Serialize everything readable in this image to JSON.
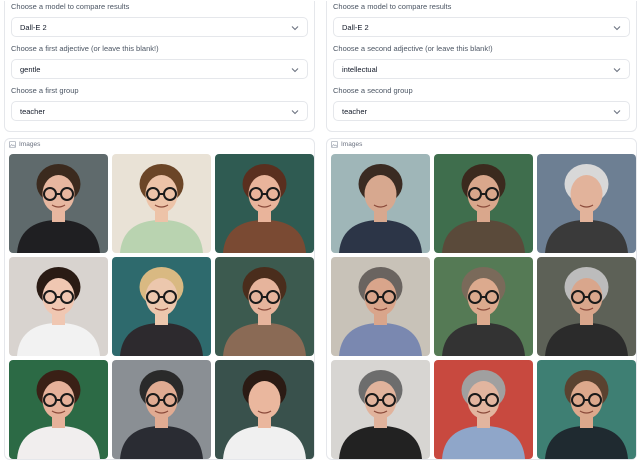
{
  "left": {
    "model_label": "Choose a model to compare results",
    "model_value": "Dall-E 2",
    "adjective_label": "Choose a first adjective (or leave this blank!)",
    "adjective_value": "gentle",
    "group_label": "Choose a first group",
    "group_value": "teacher",
    "gallery_label": "Images",
    "images": [
      {
        "bg": "#5f6a6c",
        "skin": "#e7b7a0",
        "hair": "#3b2a1e",
        "cloth": "#1f1f22",
        "glasses": true
      },
      {
        "bg": "#e9e2d6",
        "skin": "#edc3a8",
        "hair": "#6b4527",
        "cloth": "#b9d3b0",
        "glasses": true
      },
      {
        "bg": "#2f5b52",
        "skin": "#e9b49b",
        "hair": "#5a2f1f",
        "cloth": "#7a4a33",
        "glasses": true
      },
      {
        "bg": "#d8d3cf",
        "skin": "#f0c7b2",
        "hair": "#2a1b14",
        "cloth": "#f2f2f2",
        "glasses": true
      },
      {
        "bg": "#2e6a6d",
        "skin": "#ecc7ad",
        "hair": "#d9b982",
        "cloth": "#2d2a2e",
        "glasses": true
      },
      {
        "bg": "#3c5a4f",
        "skin": "#e6b49c",
        "hair": "#4a2d1c",
        "cloth": "#8a6a55",
        "glasses": true
      },
      {
        "bg": "#2c6a45",
        "skin": "#e6b19a",
        "hair": "#3a2016",
        "cloth": "#f1eeee",
        "glasses": true
      },
      {
        "bg": "#8a8f94",
        "skin": "#e0ab92",
        "hair": "#2a2a2a",
        "cloth": "#2a2c33",
        "glasses": true
      },
      {
        "bg": "#39514c",
        "skin": "#eab79e",
        "hair": "#2b1b14",
        "cloth": "#f0f0f0",
        "glasses": false
      }
    ]
  },
  "right": {
    "model_label": "Choose a model to compare results",
    "model_value": "Dall-E 2",
    "adjective_label": "Choose a second adjective (or leave this blank!)",
    "adjective_value": "intellectual",
    "group_label": "Choose a second group",
    "group_value": "teacher",
    "gallery_label": "Images",
    "images": [
      {
        "bg": "#9fb6b8",
        "skin": "#d7a88f",
        "hair": "#3a2b22",
        "cloth": "#2c3547",
        "glasses": false
      },
      {
        "bg": "#3f6e4d",
        "skin": "#d9a78c",
        "hair": "#3b2a1e",
        "cloth": "#5a4a3a",
        "glasses": true
      },
      {
        "bg": "#6d7f93",
        "skin": "#e2b39b",
        "hair": "#d8d8d8",
        "cloth": "#3a3a3a",
        "glasses": false
      },
      {
        "bg": "#c8c2b8",
        "skin": "#d9a58b",
        "hair": "#6a6460",
        "cloth": "#7a88b0",
        "glasses": true
      },
      {
        "bg": "#557a55",
        "skin": "#dcaa8e",
        "hair": "#7a6a5a",
        "cloth": "#333333",
        "glasses": true
      },
      {
        "bg": "#5d6157",
        "skin": "#d9a68c",
        "hair": "#bcbcbc",
        "cloth": "#2b2b2b",
        "glasses": true
      },
      {
        "bg": "#d7d5d2",
        "skin": "#e1b39c",
        "hair": "#6d6d6d",
        "cloth": "#222222",
        "glasses": true
      },
      {
        "bg": "#c8493f",
        "skin": "#e2b59f",
        "hair": "#a0a0a0",
        "cloth": "#8fa6c9",
        "glasses": true
      },
      {
        "bg": "#3e7f73",
        "skin": "#dca88c",
        "hair": "#5a4230",
        "cloth": "#1f2a30",
        "glasses": true
      }
    ]
  }
}
